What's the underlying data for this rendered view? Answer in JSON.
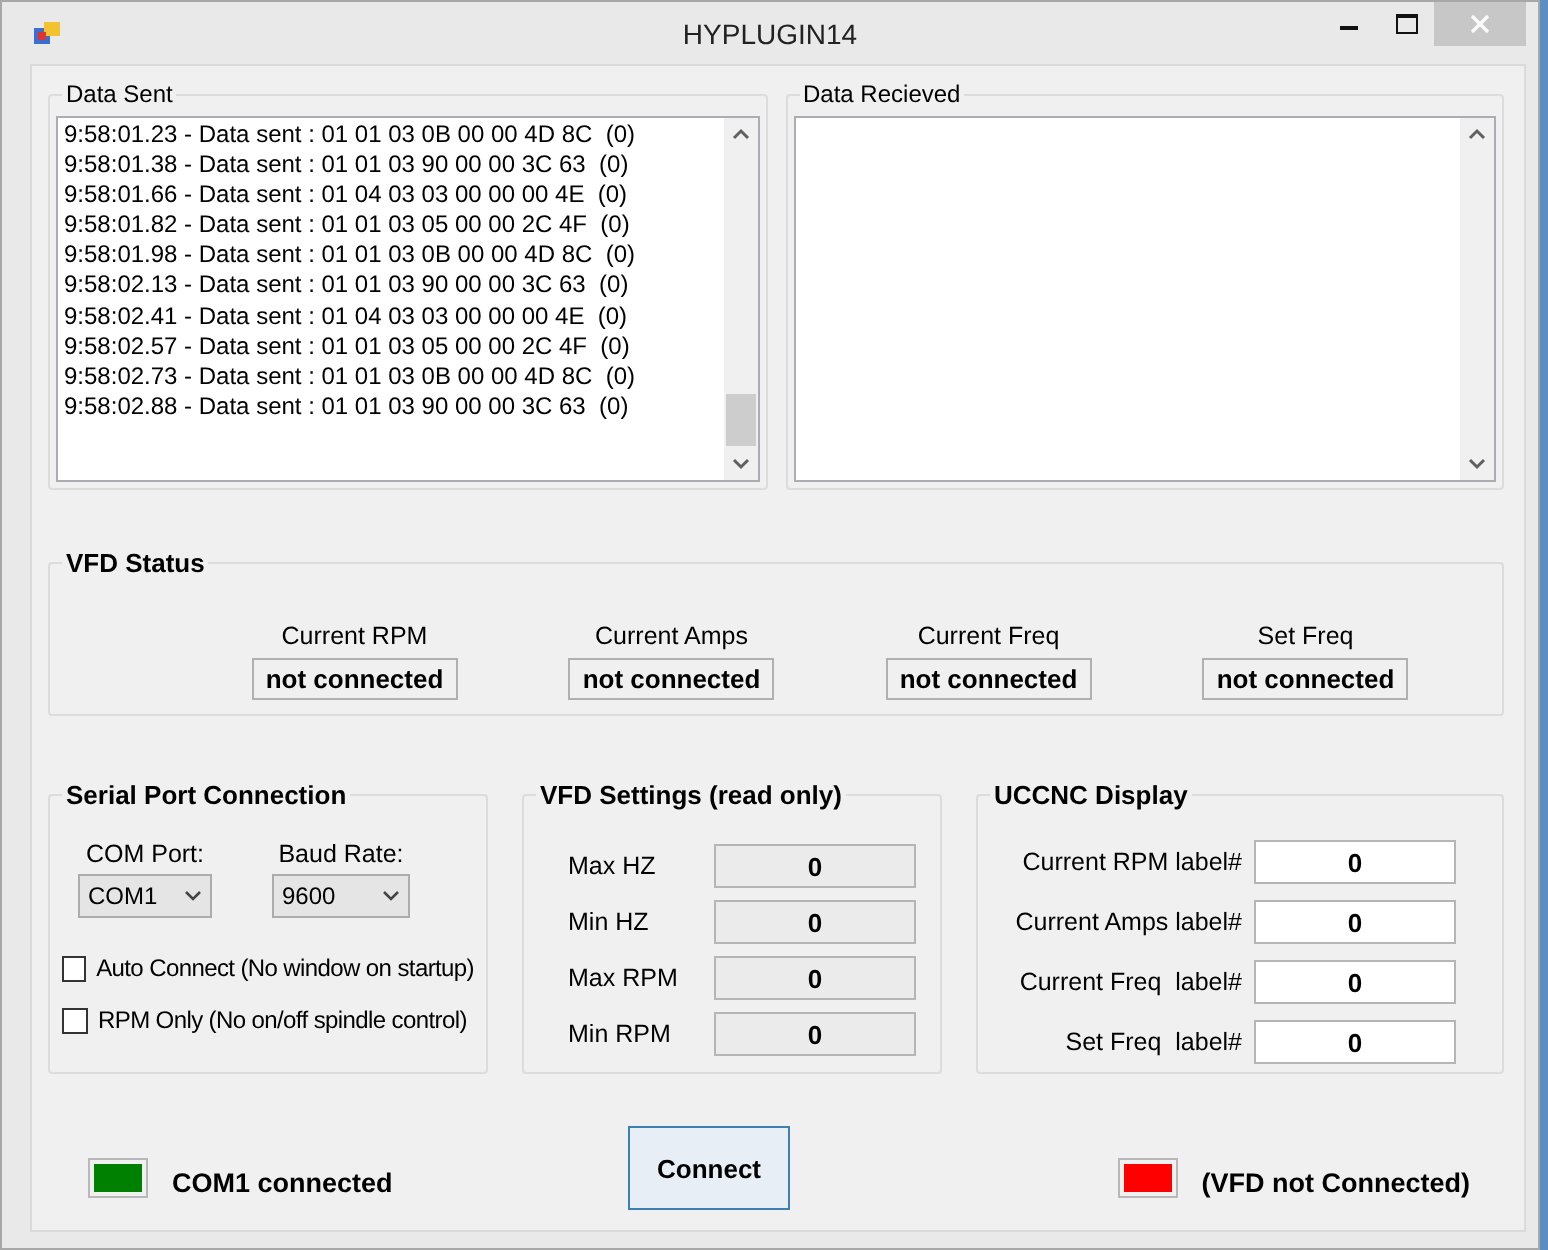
{
  "window": {
    "title": "HYPLUGIN14"
  },
  "data_sent": {
    "title": "Data Sent",
    "lines": [
      "9:58:01.23 - Data sent : 01 01 03 0B 00 00 4D 8C  (0)",
      "9:58:01.38 - Data sent : 01 01 03 90 00 00 3C 63  (0)",
      "9:58:01.66 - Data sent : 01 04 03 03 00 00 00 4E  (0)",
      "9:58:01.82 - Data sent : 01 01 03 05 00 00 2C 4F  (0)",
      "9:58:01.98 - Data sent : 01 01 03 0B 00 00 4D 8C  (0)",
      "9:58:02.13 - Data sent : 01 01 03 90 00 00 3C 63  (0)",
      "9:58:02.41 - Data sent : 01 04 03 03 00 00 00 4E  (0)",
      "9:58:02.57 - Data sent : 01 01 03 05 00 00 2C 4F  (0)",
      "9:58:02.73 - Data sent : 01 01 03 0B 00 00 4D 8C  (0)",
      "9:58:02.88 - Data sent : 01 01 03 90 00 00 3C 63  (0)"
    ]
  },
  "data_received": {
    "title": "Data Recieved"
  },
  "vfd_status": {
    "title": "VFD Status",
    "fields": [
      {
        "label": "Current RPM",
        "value": "not connected"
      },
      {
        "label": "Current Amps",
        "value": "not connected"
      },
      {
        "label": "Current Freq",
        "value": "not connected"
      },
      {
        "label": "Set Freq",
        "value": "not connected"
      }
    ]
  },
  "serial_port": {
    "title": "Serial Port Connection",
    "com_port": {
      "label": "COM Port:",
      "value": "COM1"
    },
    "baud_rate": {
      "label": "Baud Rate:",
      "value": "9600"
    },
    "options": [
      {
        "label": "Auto Connect (No window on startup)",
        "checked": false
      },
      {
        "label": "RPM Only (No on/off spindle control)",
        "checked": false
      }
    ]
  },
  "vfd_settings": {
    "title": "VFD Settings (read only)",
    "fields": [
      {
        "label": "Max HZ",
        "value": "0"
      },
      {
        "label": "Min HZ",
        "value": "0"
      },
      {
        "label": "Max RPM",
        "value": "0"
      },
      {
        "label": "Min RPM",
        "value": "0"
      }
    ]
  },
  "uccnc_display": {
    "title": "UCCNC Display",
    "fields": [
      {
        "label": "Current RPM label#",
        "value": "0"
      },
      {
        "label": "Current Amps label#",
        "value": "0"
      },
      {
        "label": "Current Freq  label#",
        "value": "0"
      },
      {
        "label": "Set Freq  label#",
        "value": "0"
      }
    ]
  },
  "status": [
    {
      "label": "COM1 connected",
      "color": "#008000"
    },
    {
      "label": "(VFD not Connected)",
      "color": "#ff0000"
    }
  ],
  "connect_button": "Connect"
}
